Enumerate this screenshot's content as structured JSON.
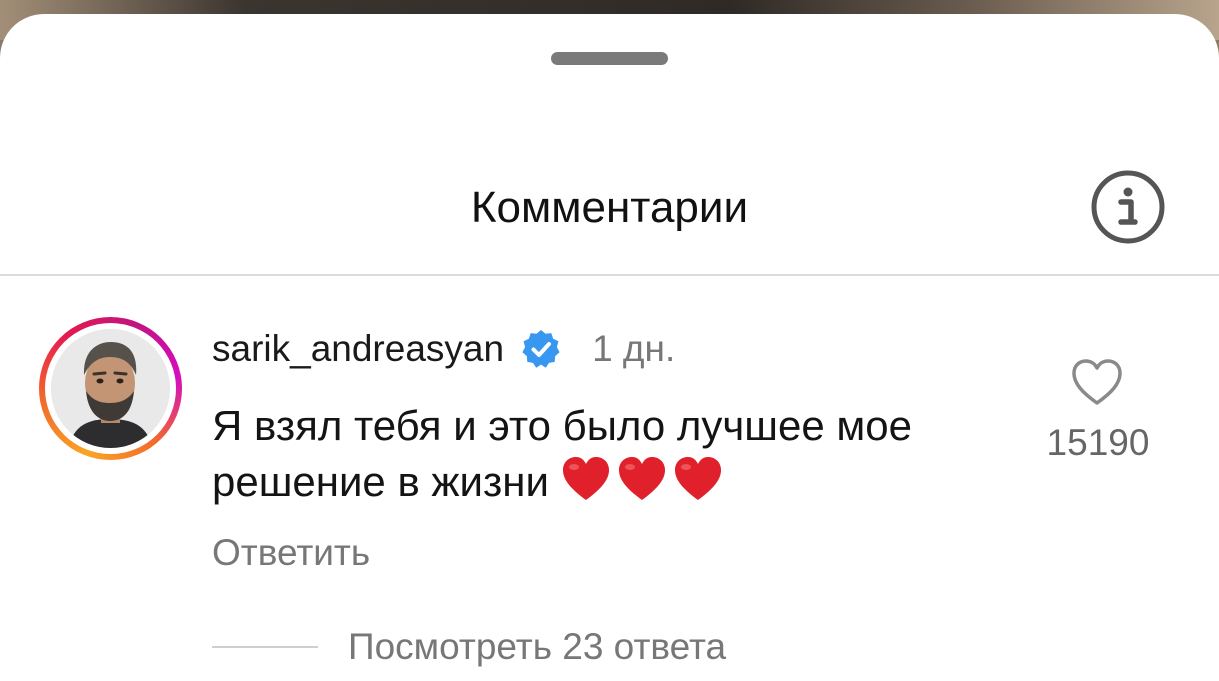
{
  "header": {
    "title": "Комментарии",
    "info_icon": "info-circle-icon"
  },
  "comment": {
    "username": "sarik_andreasyan",
    "verified_icon": "verified-badge-icon",
    "time": "1 дн.",
    "text": "Я взял тебя и это было лучшее мое решение в жизни",
    "emoji": [
      "red-heart",
      "red-heart",
      "red-heart"
    ],
    "reply_label": "Ответить",
    "like_icon": "heart-outline-icon",
    "like_count": "15190",
    "view_replies_label": "Посмотреть 23 ответа"
  },
  "colors": {
    "verified": "#3897f0",
    "heart": "#e0202a",
    "secondary_text": "#777777",
    "primary_text": "#141414"
  }
}
